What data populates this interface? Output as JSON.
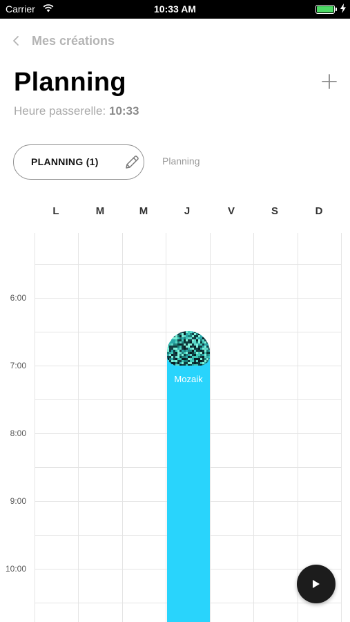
{
  "status_bar": {
    "carrier": "Carrier",
    "time": "10:33 AM"
  },
  "nav": {
    "back_label": "Mes créations"
  },
  "header": {
    "title": "Planning",
    "gateway_label": "Heure passerelle:",
    "gateway_time": "10:33"
  },
  "tabs": [
    {
      "label": "PLANNING (1)",
      "selected": true
    },
    {
      "label": "Planning",
      "selected": false
    }
  ],
  "calendar": {
    "days": [
      "L",
      "M",
      "M",
      "J",
      "V",
      "S",
      "D"
    ],
    "hours": [
      "6:00",
      "7:00",
      "8:00",
      "9:00",
      "10:00"
    ],
    "event": {
      "title": "Mozaik",
      "day": "J",
      "start": "6:30",
      "color": "#29d4fc"
    }
  },
  "icons": {
    "back": "chevron-left-icon",
    "add": "plus-icon",
    "edit": "pencil-icon",
    "play": "play-icon"
  }
}
